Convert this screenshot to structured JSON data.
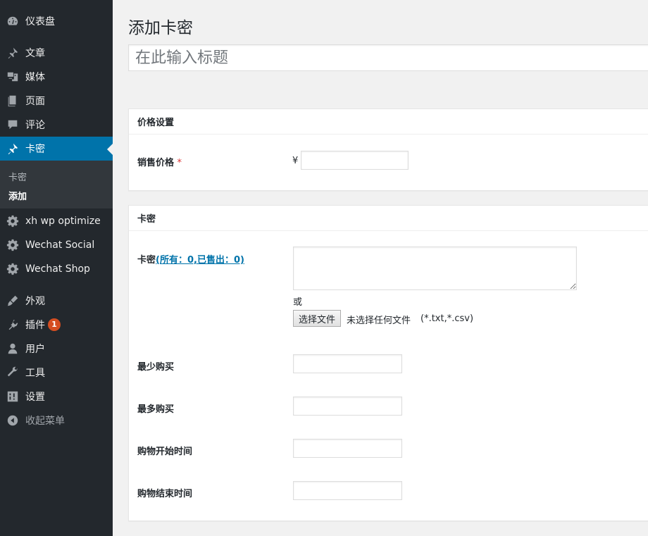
{
  "sidebar": {
    "items": [
      {
        "label": "仪表盘",
        "icon": "dashboard-icon"
      },
      {
        "label": "文章",
        "icon": "pin-icon"
      },
      {
        "label": "媒体",
        "icon": "media-icon"
      },
      {
        "label": "页面",
        "icon": "page-icon"
      },
      {
        "label": "评论",
        "icon": "comment-icon"
      },
      {
        "label": "卡密",
        "icon": "pin-icon"
      },
      {
        "label": "xh wp optimize",
        "icon": "gear-icon"
      },
      {
        "label": "Wechat Social",
        "icon": "gear-icon"
      },
      {
        "label": "Wechat Shop",
        "icon": "gear-icon"
      },
      {
        "label": "外观",
        "icon": "brush-icon"
      },
      {
        "label": "插件",
        "icon": "plugin-icon",
        "badge": "1"
      },
      {
        "label": "用户",
        "icon": "user-icon"
      },
      {
        "label": "工具",
        "icon": "wrench-icon"
      },
      {
        "label": "设置",
        "icon": "settings-icon"
      },
      {
        "label": "收起菜单",
        "icon": "collapse-icon"
      }
    ],
    "submenu": [
      "卡密",
      "添加"
    ],
    "accent": "#0073aa",
    "badge_color": "#d54e21"
  },
  "main": {
    "title": "添加卡密",
    "title_placeholder": "在此输入标题",
    "price_box": {
      "heading": "价格设置",
      "price_label": "销售价格",
      "required_mark": "*",
      "currency": "¥",
      "price_value": ""
    },
    "card_box": {
      "heading": "卡密",
      "card_label": "卡密",
      "card_link": "(所有：0,已售出：0)",
      "or_text": "或",
      "file_button": "选择文件",
      "file_status": "未选择任何文件",
      "file_types": "(*.txt,*.csv)",
      "fields": [
        {
          "label": "最少购买",
          "value": ""
        },
        {
          "label": "最多购买",
          "value": ""
        },
        {
          "label": "购物开始时间",
          "value": ""
        },
        {
          "label": "购物结束时间",
          "value": ""
        }
      ]
    }
  }
}
